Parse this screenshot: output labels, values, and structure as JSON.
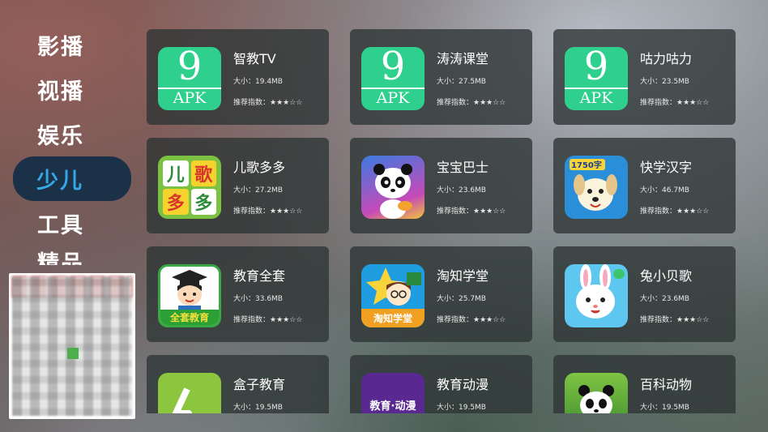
{
  "sidebar": {
    "items": [
      {
        "label": "影播"
      },
      {
        "label": "视播"
      },
      {
        "label": "娱乐"
      },
      {
        "label": "少儿"
      },
      {
        "label": "工具"
      },
      {
        "label": "精品"
      }
    ]
  },
  "apps": [
    {
      "name": "智教TV",
      "size": "大小：19.4MB",
      "rating": "推荐指数：★★★☆☆",
      "icon": "apk-icon"
    },
    {
      "name": "涛涛课堂",
      "size": "大小：27.5MB",
      "rating": "推荐指数：★★★☆☆",
      "icon": "apk-icon"
    },
    {
      "name": "咕力咕力",
      "size": "大小：23.5MB",
      "rating": "推荐指数：★★★☆☆",
      "icon": "apk-icon"
    },
    {
      "name": "儿歌多多",
      "size": "大小：27.2MB",
      "rating": "推荐指数：★★★☆☆",
      "icon": "erge-icon"
    },
    {
      "name": "宝宝巴士",
      "size": "大小：23.6MB",
      "rating": "推荐指数：★★★☆☆",
      "icon": "panda-icon"
    },
    {
      "name": "快学汉字",
      "size": "大小：46.7MB",
      "rating": "推荐指数：★★★☆☆",
      "icon": "puppy-icon"
    },
    {
      "name": "教育全套",
      "size": "大小：33.6MB",
      "rating": "推荐指数：★★★☆☆",
      "icon": "graduate-icon"
    },
    {
      "name": "淘知学堂",
      "size": "大小：25.7MB",
      "rating": "推荐指数：★★★☆☆",
      "icon": "star-icon"
    },
    {
      "name": "兔小贝歌",
      "size": "大小：23.6MB",
      "rating": "推荐指数：★★★☆☆",
      "icon": "rabbit-icon"
    },
    {
      "name": "盒子教育",
      "size": "大小：19.5MB",
      "rating": "",
      "icon": "box-icon"
    },
    {
      "name": "教育动漫",
      "size": "大小：19.5MB",
      "rating": "",
      "icon": "animation-icon"
    },
    {
      "name": "百科动物",
      "size": "大小：19.5MB",
      "rating": "",
      "icon": "panda-animal-icon"
    }
  ],
  "icon_text": {
    "apk_nine": "9",
    "apk_label": "APK",
    "erge": [
      "儿",
      "歌",
      "多",
      "多"
    ],
    "hanzi_badge": "1750字",
    "jiaoyu": "全套教育",
    "taozhi": "淘知学堂",
    "dongman": "教育·动漫"
  },
  "colors": {
    "active_nav_bg": "#1a3148",
    "active_nav_text": "#35a7e6",
    "card_bg": "#2d3434",
    "apk_green": "#2fcf8d"
  }
}
